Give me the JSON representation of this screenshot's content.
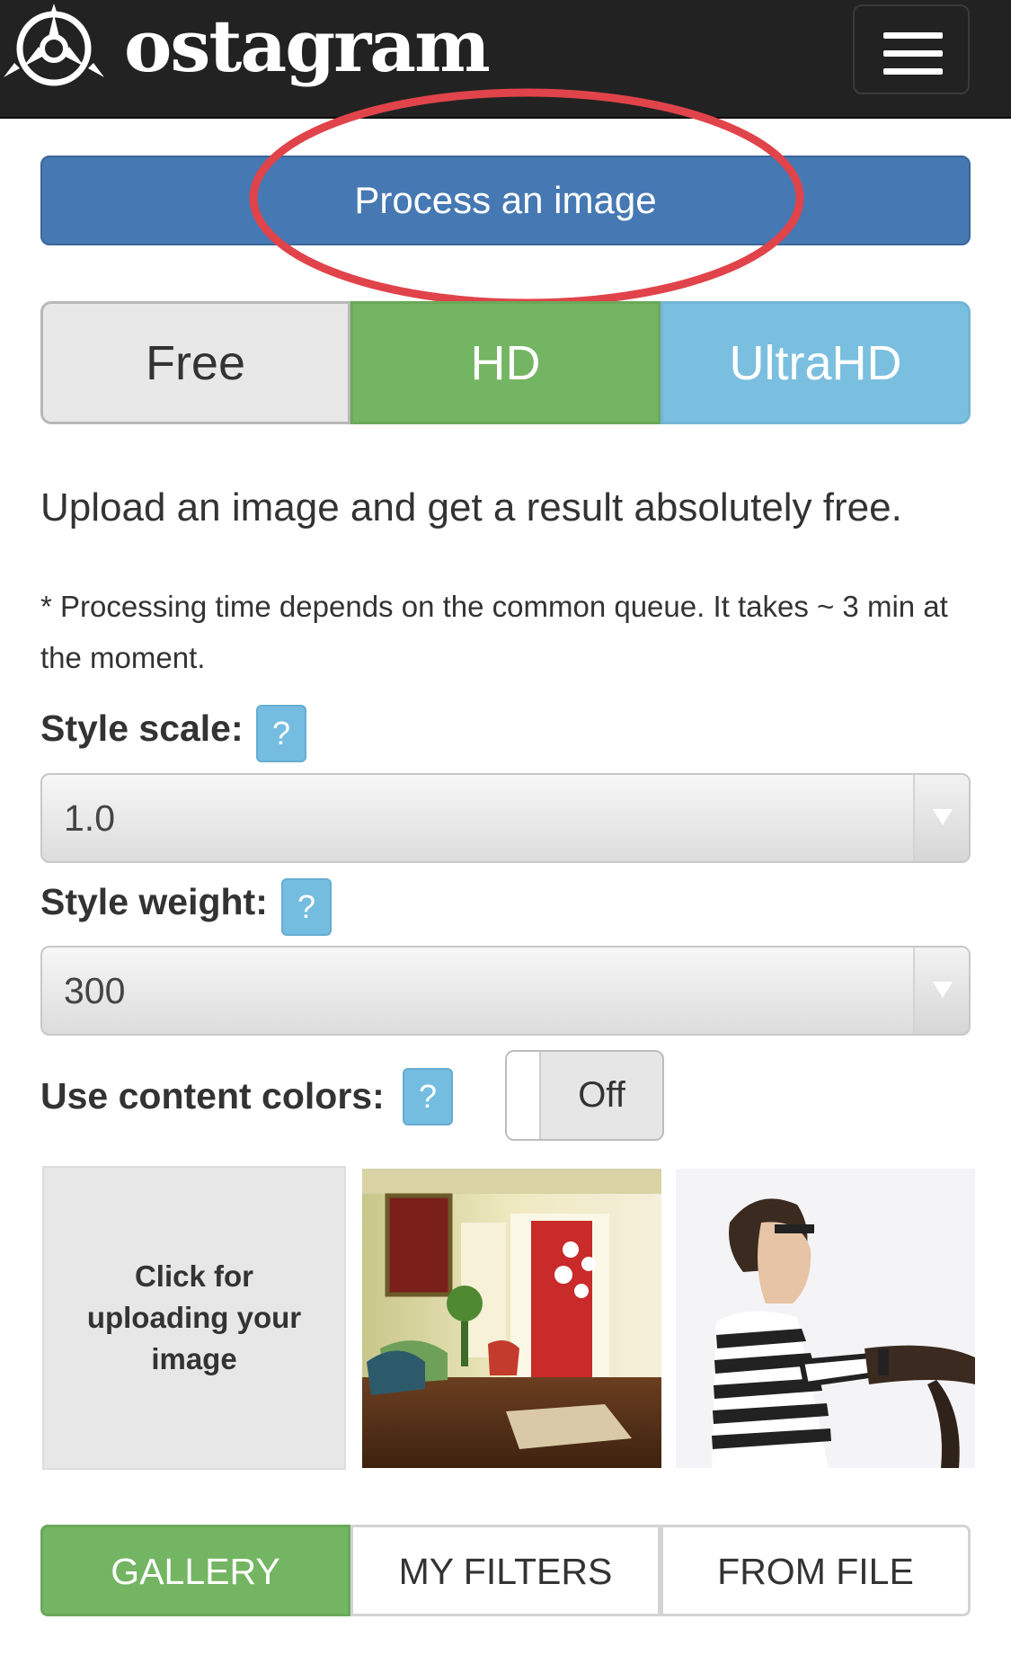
{
  "navbar": {
    "brand": "ostagram",
    "logo_icon": "ostagram-logo-icon",
    "menu_icon": "hamburger-menu-icon"
  },
  "process_button": {
    "label": "Process an image"
  },
  "plans": [
    {
      "label": "Free",
      "color": "#e8e8e8"
    },
    {
      "label": "HD",
      "color": "#73b562"
    },
    {
      "label": "UltraHD",
      "color": "#7bbfe0"
    }
  ],
  "intro": {
    "lead": "Upload an image and get a result absolutely free.",
    "note": "* Processing time depends on the common queue. It takes ~ 3 min at the moment."
  },
  "style_scale": {
    "label": "Style scale:",
    "help": "?",
    "value": "1.0"
  },
  "style_weight": {
    "label": "Style weight:",
    "help": "?",
    "value": "300"
  },
  "content_colors": {
    "label": "Use content colors:",
    "help": "?",
    "state": "Off"
  },
  "images": {
    "upload_text": "Click for uploading your image",
    "thumb1": "interior-room-photo",
    "thumb2": "hairdresser-portrait-photo"
  },
  "source_tabs": [
    {
      "label": "GALLERY",
      "active": true
    },
    {
      "label": "MY FILTERS",
      "active": false
    },
    {
      "label": "FROM FILE",
      "active": false
    }
  ],
  "colors": {
    "navbar": "#222222",
    "primary": "#4679b3",
    "success": "#73b562",
    "info": "#7bbfe0",
    "annotation_red": "#e0444a"
  }
}
